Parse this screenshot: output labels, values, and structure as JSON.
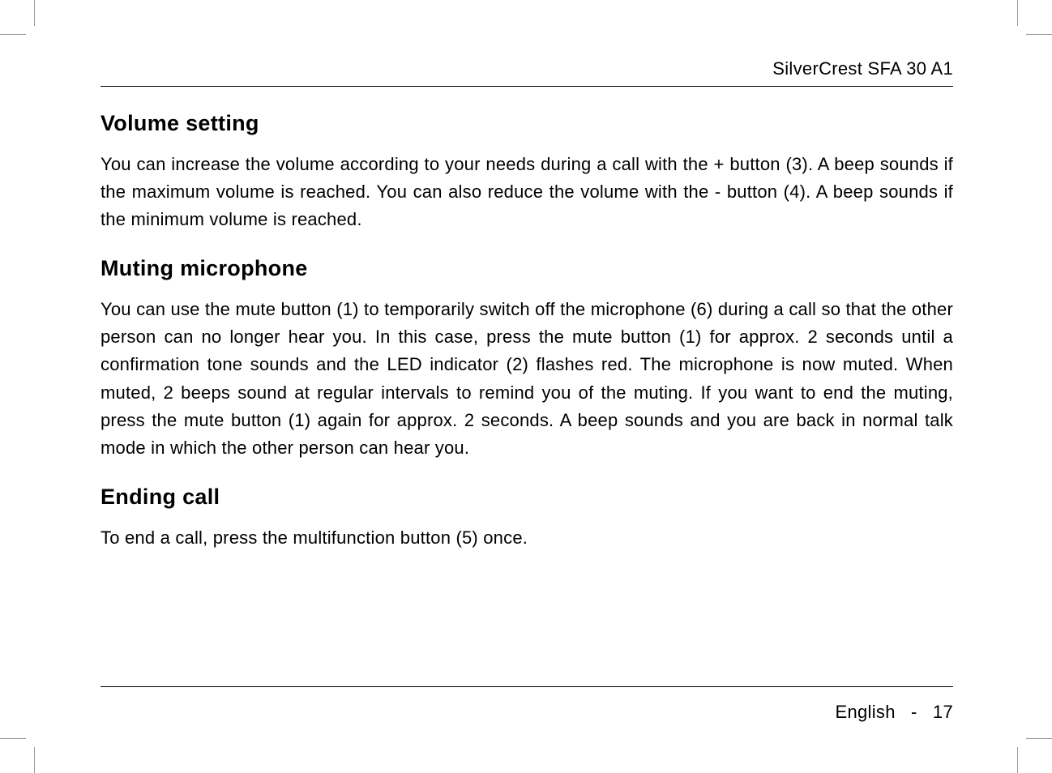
{
  "header": {
    "product_name": "SilverCrest SFA 30 A1"
  },
  "sections": {
    "volume": {
      "title": "Volume setting",
      "body": "You can increase the volume according to your needs during a call with the + button (3). A beep sounds if the maximum volume is reached. You can also reduce the volume with the - button (4). A beep sounds if the minimum volume is reached."
    },
    "muting": {
      "title": "Muting microphone",
      "body": "You can use the mute button (1) to temporarily switch off the microphone (6) during a call so that the other person can no longer hear you. In this case, press the mute button (1) for approx. 2 seconds until a confirmation tone sounds and the LED indicator (2) flashes red. The microphone is now muted. When muted, 2 beeps sound at regular intervals to remind you of the muting. If you want to end the muting, press the mute button (1) again for approx. 2 seconds. A beep sounds and you are back in normal talk mode in which the other person can hear you."
    },
    "ending": {
      "title": "Ending call",
      "body": "To end a call, press the multifunction button (5) once."
    }
  },
  "footer": {
    "language": "English",
    "separator": "-",
    "page_number": "17"
  }
}
